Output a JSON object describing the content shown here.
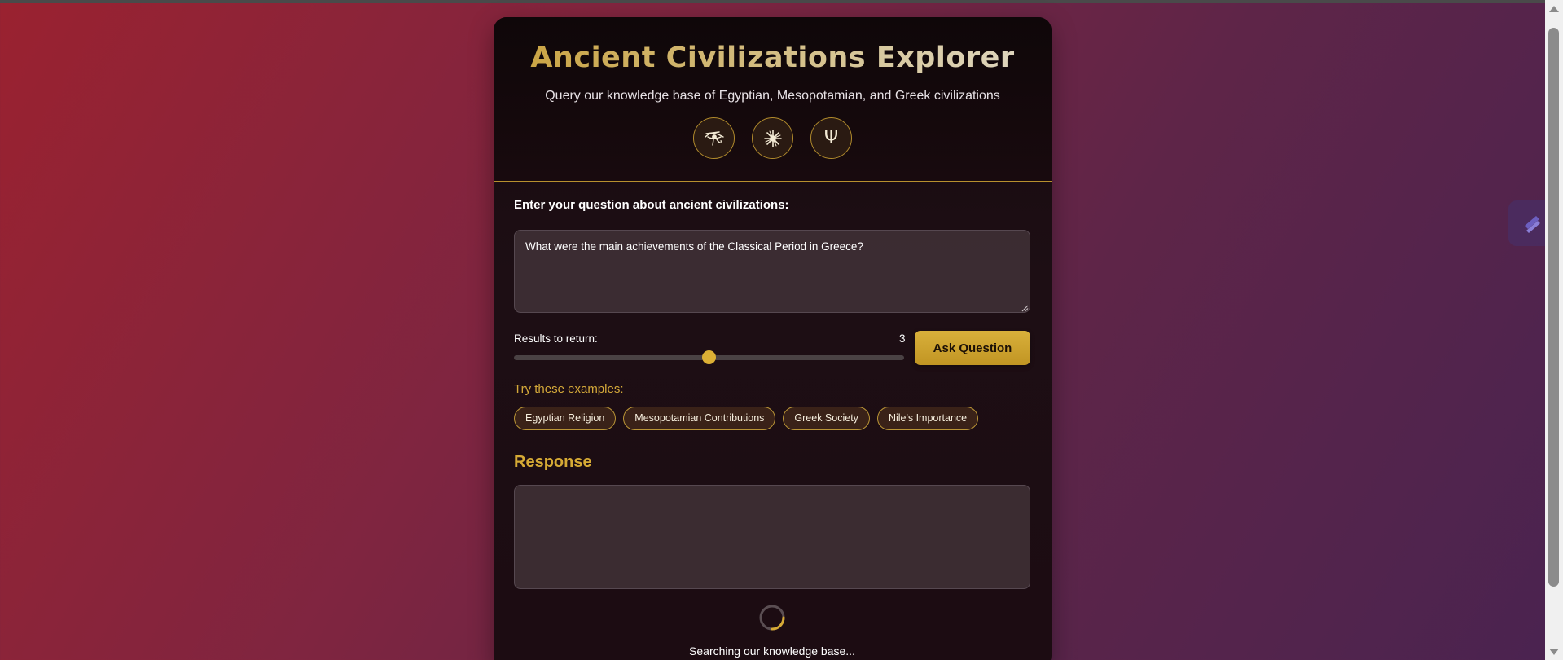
{
  "app": {
    "title": "Ancient Civilizations Explorer",
    "subtitle": "Query our knowledge base of Egyptian, Mesopotamian, and Greek civilizations"
  },
  "header_icons": [
    {
      "name": "eye-of-horus-icon"
    },
    {
      "name": "sun-symbol-icon"
    },
    {
      "name": "trident-icon",
      "glyph": "Ψ"
    }
  ],
  "form": {
    "question_label": "Enter your question about ancient civilizations:",
    "question_value": "What were the main achievements of the Classical Period in Greece?",
    "results_label": "Results to return:",
    "results_value": "3",
    "slider_fraction": 0.5,
    "ask_button": "Ask Question",
    "examples_label": "Try these examples:",
    "examples": [
      "Egyptian Religion",
      "Mesopotamian Contributions",
      "Greek Society",
      "Nile's Importance"
    ]
  },
  "response": {
    "heading": "Response",
    "content": "",
    "loading_text": "Searching our knowledge base..."
  },
  "colors": {
    "accent": "#d6aa35",
    "background_start": "#9a2230",
    "background_end": "#4a2350"
  }
}
